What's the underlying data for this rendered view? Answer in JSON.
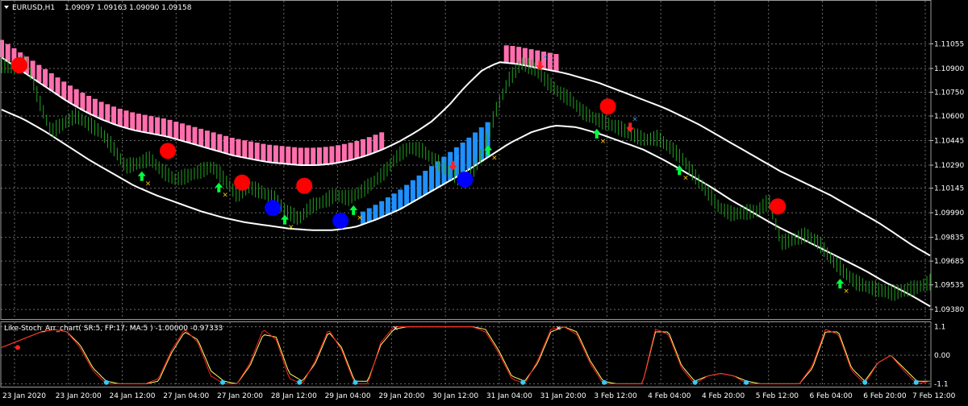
{
  "main_panel": {
    "symbol_label": "EURUSD,H1",
    "ohlc_label": "1.09097 1.09163 1.09090 1.09158",
    "menu_icon": "triangle-down-icon"
  },
  "sub_panel": {
    "indicator_label": "Like-Stoch_Arr_chart( SR:5, FP:17, MA:5 ) -1.00000 -0.97333"
  },
  "colors": {
    "background": "#000000",
    "grid": "#6b6b6b",
    "price_bars": "#22a322",
    "upper_cloud": "#ff6fae",
    "lower_cloud": "#1e90ff",
    "band_lines": "#ffffff",
    "sell_dot": "#ff0000",
    "buy_dot": "#0000ff",
    "up_arrow": "#00ff40",
    "down_arrow": "#ff2020",
    "x_mark_buy": "#ffcc00",
    "x_mark_sell": "#3399ff",
    "osc_fast": "#ff2020",
    "osc_slow": "#ffff66",
    "axis_text": "#ffffff"
  },
  "chart_data": [
    {
      "type": "line",
      "title": "EURUSD,H1",
      "ylim": [
        1.0933,
        1.1123
      ],
      "y_ticks": [
        "1.11055",
        "1.10900",
        "1.10750",
        "1.10600",
        "1.10445",
        "1.10290",
        "1.10145",
        "1.09990",
        "1.09835",
        "1.09685",
        "1.09535",
        "1.09380"
      ],
      "x_ticks": [
        "23 Jan 2020",
        "23 Jan 20:00",
        "24 Jan 12:00",
        "27 Jan 04:00",
        "27 Jan 20:00",
        "28 Jan 12:00",
        "29 Jan 04:00",
        "29 Jan 20:00",
        "30 Jan 12:00",
        "31 Jan 04:00",
        "31 Jan 20:00",
        "3 Feb 12:00",
        "4 Feb 04:00",
        "4 Feb 20:00",
        "5 Feb 12:00",
        "6 Feb 04:00",
        "6 Feb 20:00",
        "7 Feb 12:00"
      ],
      "grid": true,
      "series": [
        {
          "role": "price",
          "values": [
            1.1092,
            1.109,
            1.1095,
            1.107,
            1.105,
            1.1055,
            1.106,
            1.1055,
            1.105,
            1.104,
            1.1028,
            1.103,
            1.1033,
            1.1025,
            1.102,
            1.1022,
            1.1025,
            1.1028,
            1.102,
            1.101,
            1.1015,
            1.1012,
            1.1008,
            1.1,
            1.0995,
            1.1003,
            1.1006,
            1.101,
            1.1008,
            1.1012,
            1.1018,
            1.1025,
            1.1035,
            1.104,
            1.1038,
            1.1032,
            1.1026,
            1.102,
            1.1024,
            1.104,
            1.1065,
            1.1083,
            1.1093,
            1.109,
            1.1082,
            1.1075,
            1.107,
            1.1062,
            1.1058,
            1.1055,
            1.1052,
            1.1048,
            1.1045,
            1.1046,
            1.104,
            1.1033,
            1.1022,
            1.1012,
            1.1002,
            1.0998,
            1.0999,
            1.1,
            1.1006,
            1.098,
            1.0982,
            1.0985,
            1.098,
            1.097,
            1.0962,
            1.0955,
            1.0952,
            1.095,
            1.0948,
            1.095,
            1.0952,
            1.0955
          ]
        },
        {
          "role": "upper_band",
          "values": [
            1.1097,
            1.109,
            1.1083,
            1.1076,
            1.1069,
            1.1063,
            1.1058,
            1.1054,
            1.1051,
            1.1049,
            1.1047,
            1.1044,
            1.1041,
            1.1038,
            1.1035,
            1.1033,
            1.1031,
            1.103,
            1.1029,
            1.1029,
            1.103,
            1.1032,
            1.1035,
            1.1039,
            1.1044,
            1.105,
            1.1057,
            1.1067,
            1.1079,
            1.1089,
            1.1094,
            1.1093,
            1.1091,
            1.1089,
            1.1087,
            1.1084,
            1.1081,
            1.1077,
            1.1073,
            1.1069,
            1.1065,
            1.106,
            1.1055,
            1.1049,
            1.1043,
            1.1037,
            1.1031,
            1.1025,
            1.102,
            1.1015,
            1.101,
            1.1004,
            1.0998,
            1.0992,
            1.0985,
            1.0978,
            1.0972
          ]
        },
        {
          "role": "lower_band",
          "values": [
            1.1064,
            1.1058,
            1.105,
            1.1041,
            1.1032,
            1.1024,
            1.1016,
            1.101,
            1.1005,
            1.1,
            1.0996,
            1.0993,
            1.0991,
            1.0989,
            1.0988,
            1.0988,
            1.099,
            1.0995,
            1.1001,
            1.1009,
            1.1017,
            1.1025,
            1.1034,
            1.1043,
            1.105,
            1.1054,
            1.1053,
            1.1049,
            1.1044,
            1.1039,
            1.1032,
            1.1024,
            1.1016,
            1.1007,
            1.0999,
            1.0991,
            1.0984,
            1.0977,
            1.097,
            1.0963,
            1.0955,
            1.0948,
            1.094
          ]
        }
      ],
      "markers": {
        "sell_dots": [
          [
            0.019,
            1.1092
          ],
          [
            0.179,
            1.1038
          ],
          [
            0.259,
            1.1018
          ],
          [
            0.326,
            1.1016
          ],
          [
            0.653,
            1.1066
          ],
          [
            0.836,
            1.1003
          ]
        ],
        "buy_dots": [
          [
            0.292,
            1.1002
          ],
          [
            0.365,
            1.0994
          ],
          [
            0.499,
            1.102
          ]
        ]
      }
    },
    {
      "type": "line",
      "title": "Like-Stoch_Arr_chart( SR:5, FP:17, MA:5 ) -1.00000 -0.97333",
      "ylim": [
        -1.15,
        1.15
      ],
      "y_ticks": [
        "1.1",
        "0.00",
        "-1.1"
      ],
      "series": [
        {
          "role": "fast",
          "values": [
            0.3,
            0.5,
            0.7,
            0.9,
            1.0,
            0.9,
            0.3,
            -0.6,
            -1.1,
            -1.1,
            -1.1,
            -1.1,
            -0.9,
            0.2,
            1.0,
            0.5,
            -0.8,
            -1.1,
            -1.1,
            -0.3,
            1.0,
            0.6,
            -0.9,
            -1.1,
            -0.2,
            1.0,
            0.2,
            -1.1,
            -1.1,
            0.5,
            1.1,
            1.1,
            1.1,
            1.1,
            1.1,
            1.1,
            1.1,
            0.9,
            0.1,
            -0.9,
            -1.1,
            -0.2,
            1.0,
            1.1,
            0.8,
            -0.3,
            -1.1,
            -1.1,
            -1.1,
            -1.1,
            1.0,
            0.8,
            -0.5,
            -1.1,
            -0.8,
            -0.7,
            -0.8,
            -1.1,
            -1.1,
            -1.1,
            -1.1,
            -1.1,
            -0.4,
            1.0,
            0.8,
            -0.6,
            -1.1,
            -0.3,
            0.0,
            -0.6,
            -1.1,
            -1.0
          ]
        },
        {
          "role": "slow",
          "values": [
            0.3,
            0.5,
            0.7,
            0.9,
            1.0,
            0.9,
            0.4,
            -0.5,
            -1.0,
            -1.1,
            -1.1,
            -1.1,
            -1.0,
            0.1,
            0.9,
            0.6,
            -0.6,
            -1.0,
            -1.1,
            -0.4,
            0.8,
            0.7,
            -0.7,
            -1.0,
            -0.3,
            0.9,
            0.3,
            -1.0,
            -1.0,
            0.4,
            1.0,
            1.1,
            1.1,
            1.1,
            1.1,
            1.1,
            1.1,
            1.0,
            0.2,
            -0.8,
            -1.0,
            -0.3,
            0.9,
            1.1,
            0.9,
            -0.2,
            -1.0,
            -1.1,
            -1.1,
            -1.1,
            0.9,
            0.9,
            -0.4,
            -1.0,
            -0.8,
            -0.7,
            -0.8,
            -1.0,
            -1.1,
            -1.1,
            -1.1,
            -1.1,
            -0.5,
            0.9,
            0.9,
            -0.5,
            -1.0,
            -0.3,
            0.0,
            -0.5,
            -1.0,
            -1.0
          ]
        }
      ]
    }
  ]
}
